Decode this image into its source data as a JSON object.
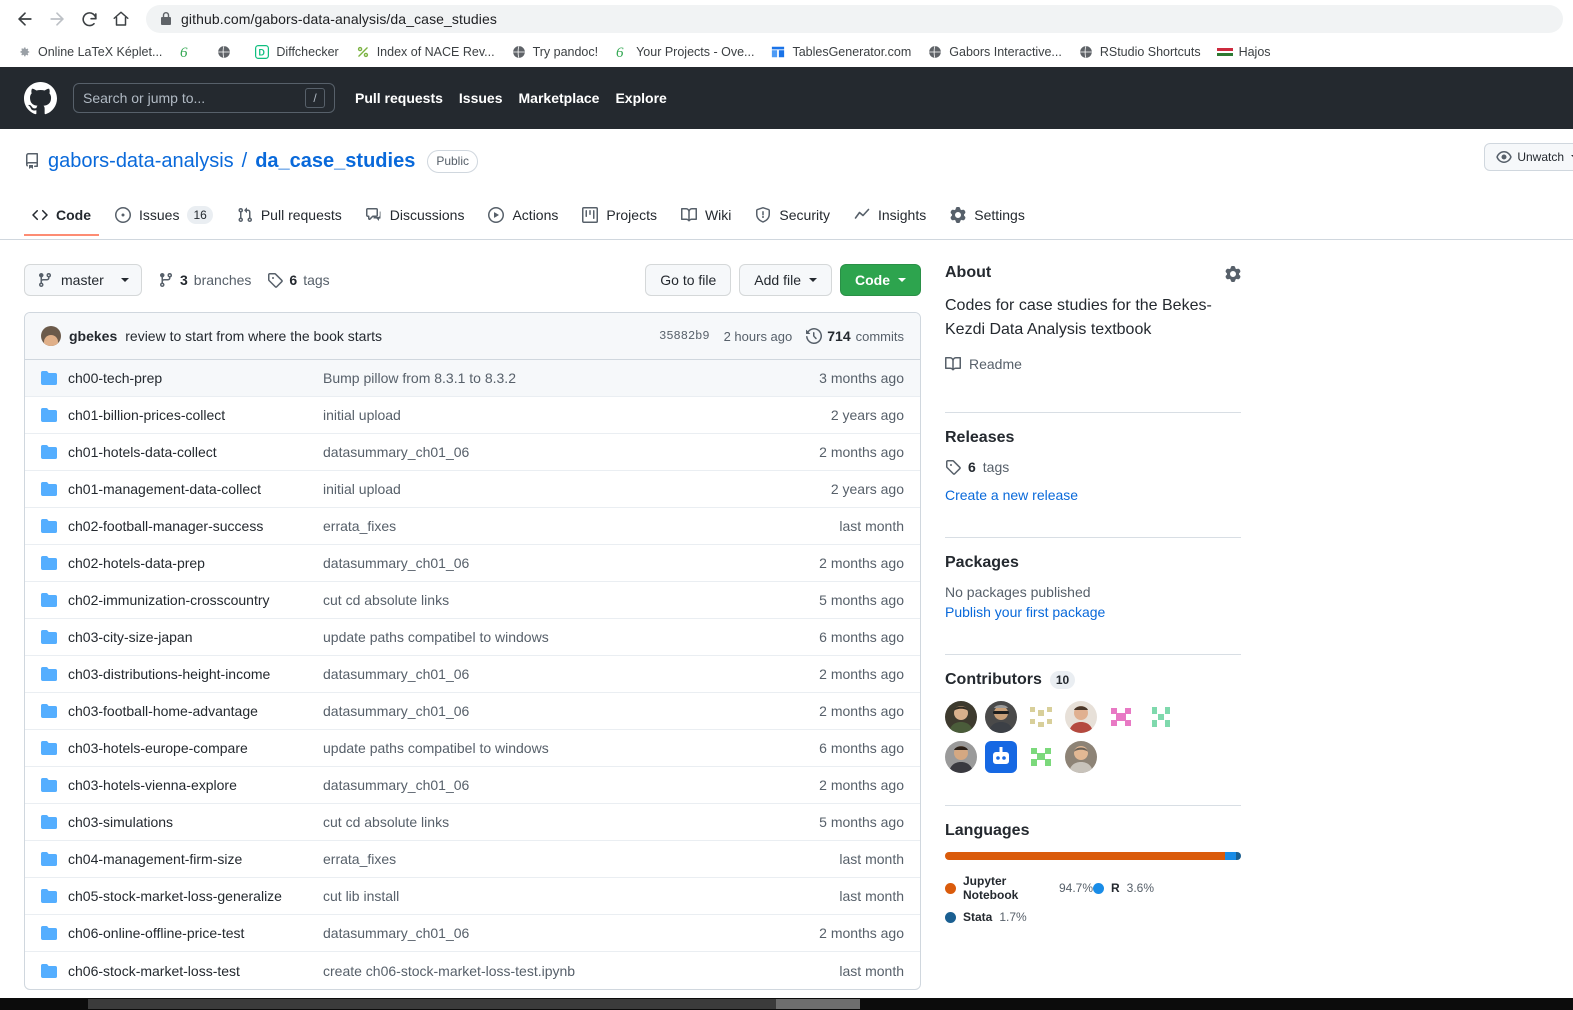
{
  "browser": {
    "url": "github.com/gabors-data-analysis/da_case_studies",
    "back_icon": "back-arrow-icon",
    "forward_icon": "forward-arrow-icon",
    "reload_icon": "reload-icon",
    "home_icon": "home-icon",
    "lock_icon": "lock-icon",
    "bookmarks": [
      {
        "label": "Online LaTeX Képlet...",
        "icon": "gear-favicon",
        "color": "#9aa0a6"
      },
      {
        "label": "",
        "icon": "g-favicon",
        "color": "#34a853"
      },
      {
        "label": "",
        "icon": "globe-favicon",
        "color": "#5f6368"
      },
      {
        "label": "Diffchecker",
        "icon": "diffchecker-favicon",
        "color": "#0fbf7f"
      },
      {
        "label": "Index of NACE Rev...",
        "icon": "percent-favicon",
        "color": "#7cb342"
      },
      {
        "label": "Try pandoc!",
        "icon": "globe-favicon",
        "color": "#5f6368"
      },
      {
        "label": "Your Projects - Ove...",
        "icon": "g-favicon",
        "color": "#34a853"
      },
      {
        "label": "TablesGenerator.com",
        "icon": "table-favicon",
        "color": "#1a73e8"
      },
      {
        "label": "Gabors Interactive...",
        "icon": "globe-favicon",
        "color": "#5f6368"
      },
      {
        "label": "RStudio Shortcuts",
        "icon": "globe-favicon",
        "color": "#5f6368"
      },
      {
        "label": "Hajos",
        "icon": "hungary-flag-favicon",
        "color": "#cd2a3e"
      }
    ]
  },
  "gh_header": {
    "logo_icon": "github-mark-icon",
    "search_placeholder": "Search or jump to...",
    "search_shortcut": "/",
    "nav": [
      {
        "label": "Pull requests"
      },
      {
        "label": "Issues"
      },
      {
        "label": "Marketplace"
      },
      {
        "label": "Explore"
      }
    ]
  },
  "repo": {
    "icon": "repo-icon",
    "owner": "gabors-data-analysis",
    "separator": "/",
    "name": "da_case_studies",
    "visibility": "Public",
    "watch_button": {
      "label": "Unwatch",
      "icon": "eye-icon"
    },
    "tabs": [
      {
        "label": "Code",
        "icon": "code-icon",
        "count": null,
        "selected": true
      },
      {
        "label": "Issues",
        "icon": "issue-opened-icon",
        "count": "16",
        "selected": false
      },
      {
        "label": "Pull requests",
        "icon": "git-pull-request-icon",
        "count": null,
        "selected": false
      },
      {
        "label": "Discussions",
        "icon": "comment-discussion-icon",
        "count": null,
        "selected": false
      },
      {
        "label": "Actions",
        "icon": "play-icon",
        "count": null,
        "selected": false
      },
      {
        "label": "Projects",
        "icon": "project-icon",
        "count": null,
        "selected": false
      },
      {
        "label": "Wiki",
        "icon": "book-icon",
        "count": null,
        "selected": false
      },
      {
        "label": "Security",
        "icon": "shield-icon",
        "count": null,
        "selected": false
      },
      {
        "label": "Insights",
        "icon": "graph-icon",
        "count": null,
        "selected": false
      },
      {
        "label": "Settings",
        "icon": "gear-icon",
        "count": null,
        "selected": false
      }
    ]
  },
  "toolbar": {
    "branch": "master",
    "branch_icon": "git-branch-icon",
    "branches_count": "3",
    "branches_label": "branches",
    "tags_count": "6",
    "tags_label": "tags",
    "tag_icon": "tag-icon",
    "go_to_file": "Go to file",
    "add_file": "Add file",
    "code": "Code"
  },
  "commit_bar": {
    "avatar": "user-avatar",
    "author": "gbekes",
    "message": "review to start from where the book starts",
    "sha": "35882b9",
    "time": "2 hours ago",
    "history_icon": "history-icon",
    "commits_count": "714",
    "commits_label": "commits"
  },
  "files": [
    {
      "icon": "folder-icon",
      "name": "ch00-tech-prep",
      "message": "Bump pillow from 8.3.1 to 8.3.2",
      "time": "3 months ago"
    },
    {
      "icon": "folder-icon",
      "name": "ch01-billion-prices-collect",
      "message": "initial upload",
      "time": "2 years ago"
    },
    {
      "icon": "folder-icon",
      "name": "ch01-hotels-data-collect",
      "message": "datasummary_ch01_06",
      "time": "2 months ago"
    },
    {
      "icon": "folder-icon",
      "name": "ch01-management-data-collect",
      "message": "initial upload",
      "time": "2 years ago"
    },
    {
      "icon": "folder-icon",
      "name": "ch02-football-manager-success",
      "message": "errata_fixes",
      "time": "last month"
    },
    {
      "icon": "folder-icon",
      "name": "ch02-hotels-data-prep",
      "message": "datasummary_ch01_06",
      "time": "2 months ago"
    },
    {
      "icon": "folder-icon",
      "name": "ch02-immunization-crosscountry",
      "message": "cut cd absolute links",
      "time": "5 months ago"
    },
    {
      "icon": "folder-icon",
      "name": "ch03-city-size-japan",
      "message": "update paths compatibel to windows",
      "time": "6 months ago"
    },
    {
      "icon": "folder-icon",
      "name": "ch03-distributions-height-income",
      "message": "datasummary_ch01_06",
      "time": "2 months ago"
    },
    {
      "icon": "folder-icon",
      "name": "ch03-football-home-advantage",
      "message": "datasummary_ch01_06",
      "time": "2 months ago"
    },
    {
      "icon": "folder-icon",
      "name": "ch03-hotels-europe-compare",
      "message": "update paths compatibel to windows",
      "time": "6 months ago"
    },
    {
      "icon": "folder-icon",
      "name": "ch03-hotels-vienna-explore",
      "message": "datasummary_ch01_06",
      "time": "2 months ago"
    },
    {
      "icon": "folder-icon",
      "name": "ch03-simulations",
      "message": "cut cd absolute links",
      "time": "5 months ago"
    },
    {
      "icon": "folder-icon",
      "name": "ch04-management-firm-size",
      "message": "errata_fixes",
      "time": "last month"
    },
    {
      "icon": "folder-icon",
      "name": "ch05-stock-market-loss-generalize",
      "message": "cut lib install",
      "time": "last month"
    },
    {
      "icon": "folder-icon",
      "name": "ch06-online-offline-price-test",
      "message": "datasummary_ch01_06",
      "time": "2 months ago"
    },
    {
      "icon": "folder-icon",
      "name": "ch06-stock-market-loss-test",
      "message": "create ch06-stock-market-loss-test.ipynb",
      "time": "last month"
    }
  ],
  "sidebar": {
    "about": {
      "title": "About",
      "gear_icon": "gear-icon",
      "description": "Codes for case studies for the Bekes-Kezdi Data Analysis textbook",
      "readme_label": "Readme",
      "readme_icon": "book-icon"
    },
    "releases": {
      "title": "Releases",
      "tags_count": "6",
      "tags_label": "tags",
      "tag_icon": "tag-icon",
      "create_link": "Create a new release"
    },
    "packages": {
      "title": "Packages",
      "empty_text": "No packages published",
      "publish_link": "Publish your first package"
    },
    "contributors": {
      "title": "Contributors",
      "count": "10",
      "avatars": [
        {
          "name": "contributor-avatar-1",
          "color": "#3d3a2e",
          "kind": "photo"
        },
        {
          "name": "contributor-avatar-2",
          "color": "#4a4a4a",
          "kind": "photo"
        },
        {
          "name": "contributor-avatar-3",
          "color": "#d8cf9a",
          "kind": "identicon"
        },
        {
          "name": "contributor-avatar-4",
          "color": "#c9756a",
          "kind": "photo"
        },
        {
          "name": "contributor-avatar-5",
          "color": "#e879c4",
          "kind": "identicon"
        },
        {
          "name": "contributor-avatar-6",
          "color": "#7fd9ad",
          "kind": "identicon"
        },
        {
          "name": "contributor-avatar-7",
          "color": "#5a5a5a",
          "kind": "photo"
        },
        {
          "name": "contributor-avatar-8",
          "color": "#1668e3",
          "kind": "bot"
        },
        {
          "name": "contributor-avatar-9",
          "color": "#7bd97b",
          "kind": "identicon"
        },
        {
          "name": "contributor-avatar-10",
          "color": "#8d8376",
          "kind": "photo"
        }
      ]
    },
    "languages": {
      "title": "Languages",
      "items": [
        {
          "name": "Jupyter Notebook",
          "pct": "94.7%",
          "value": 94.7,
          "color": "#DA5B0B"
        },
        {
          "name": "R",
          "pct": "3.6%",
          "value": 3.6,
          "color": "#198CE7"
        },
        {
          "name": "Stata",
          "pct": "1.7%",
          "value": 1.7,
          "color": "#1a5f91"
        }
      ]
    }
  },
  "scrollbar": {
    "name": "horizontal-scrollbar"
  }
}
